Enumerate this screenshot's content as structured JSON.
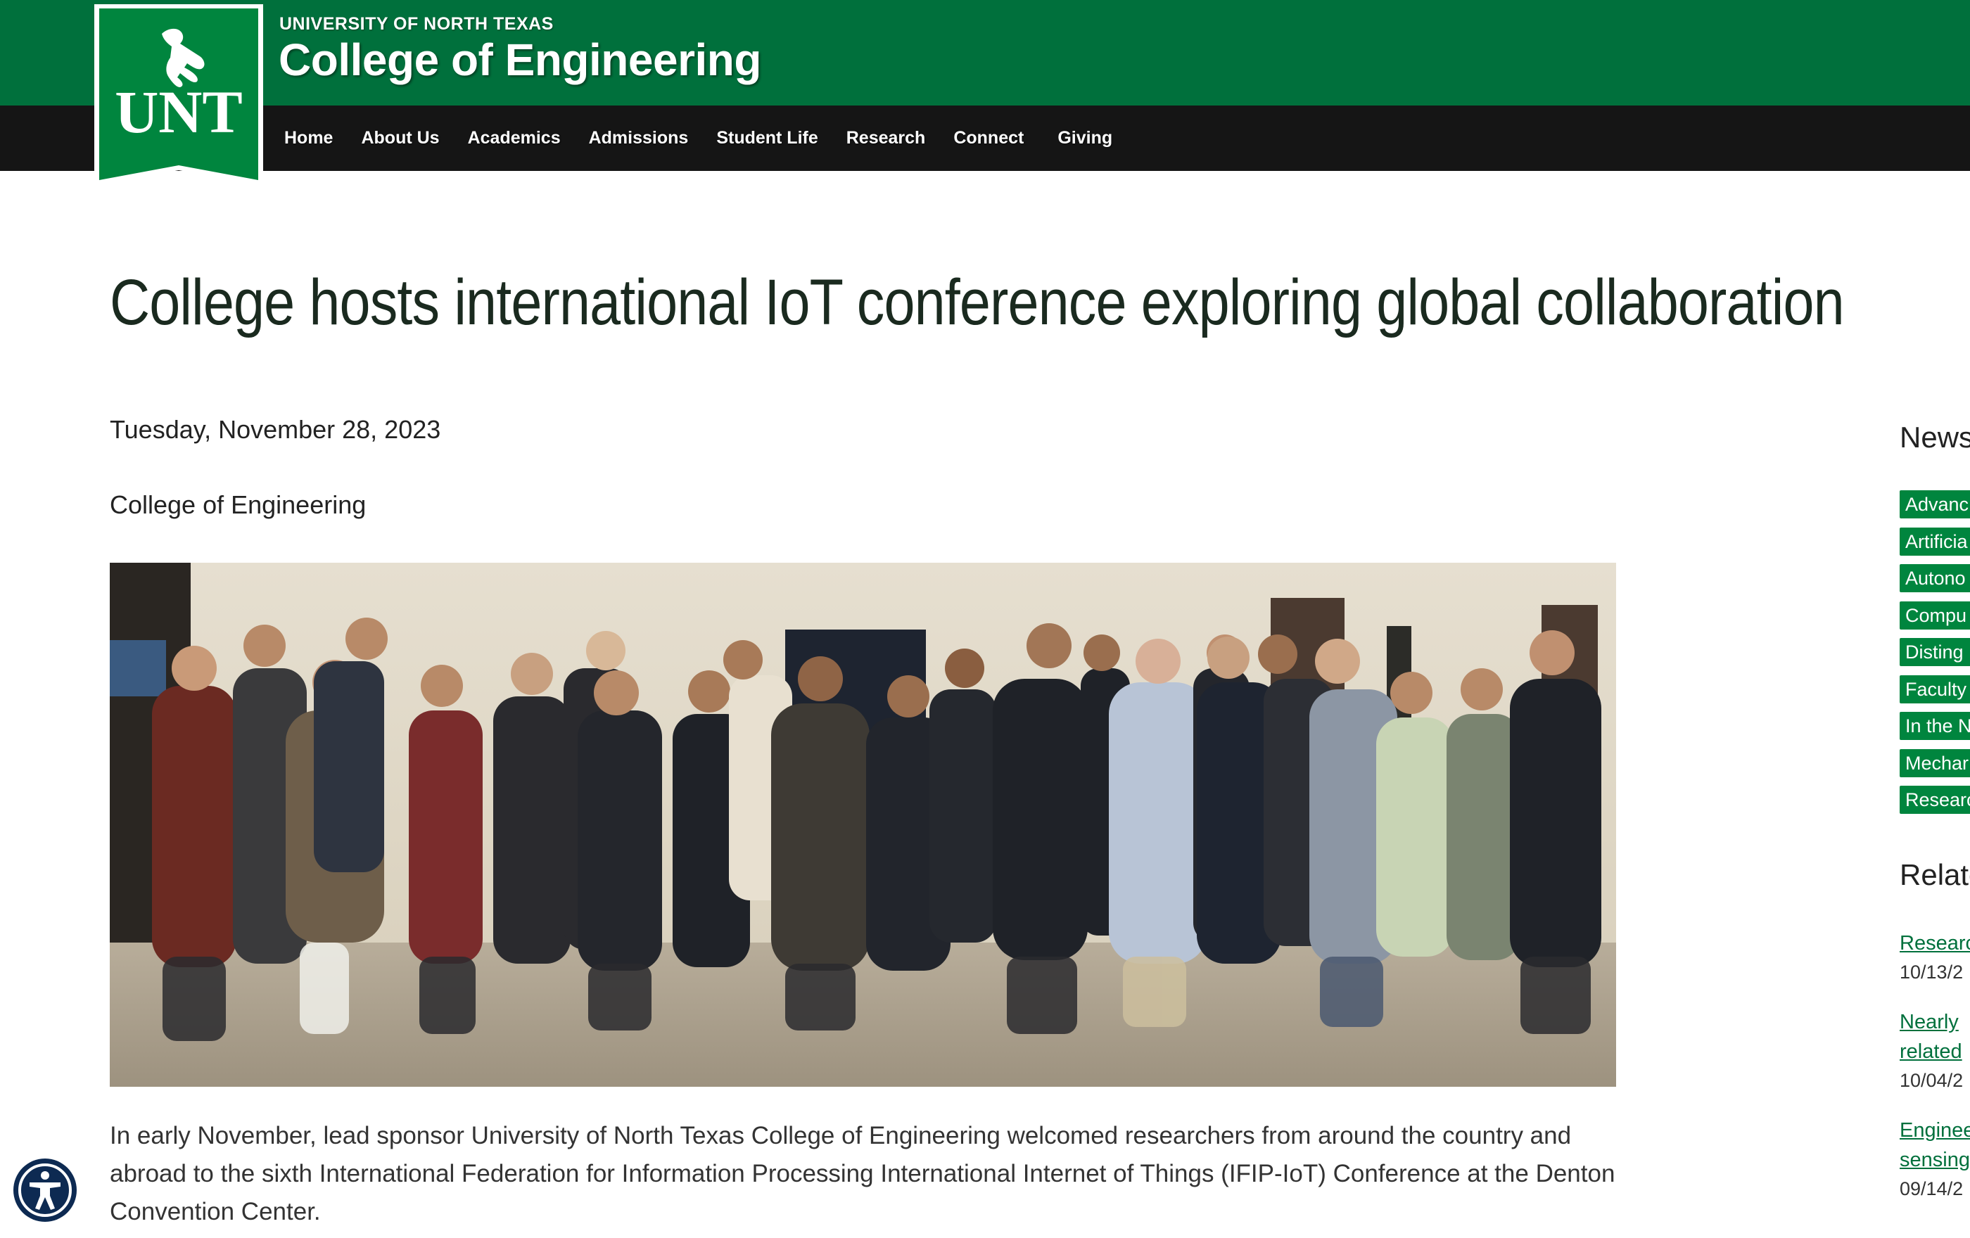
{
  "header": {
    "university": "UNIVERSITY OF NORTH TEXAS",
    "college": "College of Engineering",
    "logo_text": "UNT"
  },
  "nav": {
    "items": [
      "Home",
      "About Us",
      "Academics",
      "Admissions",
      "Student Life",
      "Research",
      "Connect",
      "Giving"
    ]
  },
  "article": {
    "title": "College hosts international IoT conference exploring global collaboration",
    "date": "Tuesday, November 28, 2023",
    "byline": "College of Engineering",
    "body": "In early November, lead sponsor University of North Texas College of Engineering welcomed researchers from around the country and abroad to the sixth International Federation for Information Processing International Internet of Things (IFIP-IoT) Conference at the Denton Convention Center."
  },
  "sidebar": {
    "news_heading": "News",
    "tags": [
      "Advanc",
      "Artificia",
      "Autono",
      "Compu",
      "Disting",
      "Faculty",
      "In the N",
      "Mechar",
      "Researc"
    ],
    "related_heading": "Relate",
    "related": [
      {
        "lines": [
          "Researc"
        ],
        "date": "10/13/2"
      },
      {
        "lines": [
          "Nearly",
          "related"
        ],
        "date": "10/04/2"
      },
      {
        "lines": [
          "Enginee",
          "sensing"
        ],
        "date": "09/14/2"
      }
    ]
  },
  "colors": {
    "brand_green": "#00703c",
    "tag_green": "#00853e",
    "nav_black": "#151515"
  },
  "icons": {
    "logo": "unt-eagle-logo",
    "accessibility": "accessibility-icon"
  }
}
